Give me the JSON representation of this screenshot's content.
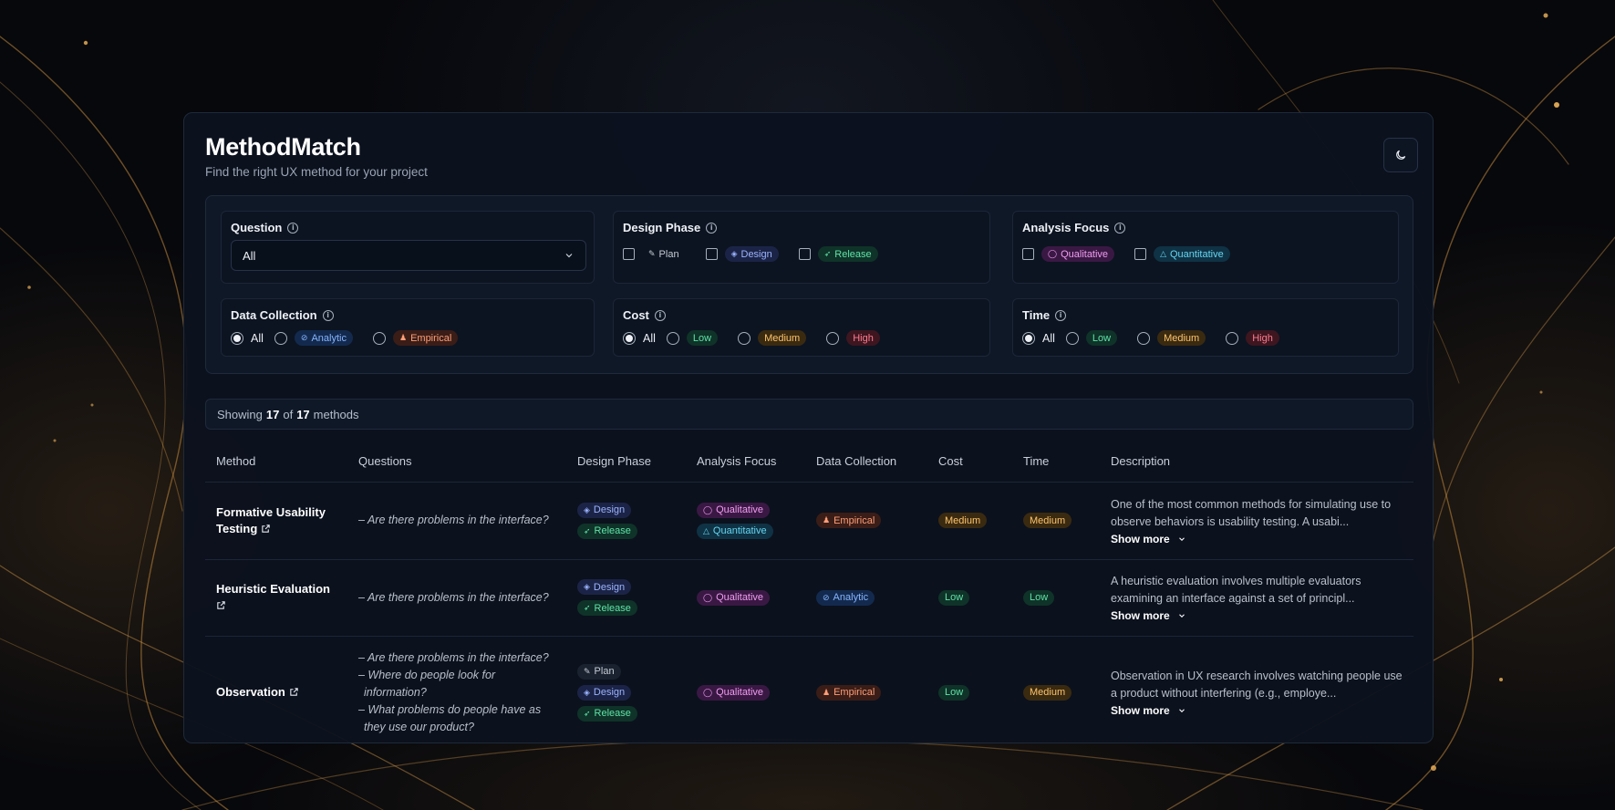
{
  "app": {
    "title": "MethodMatch",
    "subtitle": "Find the right UX method for your project",
    "theme_icon": "moon-icon"
  },
  "filters": {
    "question": {
      "label": "Question",
      "value": "All"
    },
    "design_phase": {
      "label": "Design Phase",
      "options": [
        "Plan",
        "Design",
        "Release"
      ]
    },
    "analysis_focus": {
      "label": "Analysis Focus",
      "options": [
        "Qualitative",
        "Quantitative"
      ]
    },
    "data_collection": {
      "label": "Data Collection",
      "selected": "All",
      "options": [
        "All",
        "Analytic",
        "Empirical"
      ]
    },
    "cost": {
      "label": "Cost",
      "selected": "All",
      "options": [
        "All",
        "Low",
        "Medium",
        "High"
      ]
    },
    "time": {
      "label": "Time",
      "selected": "All",
      "options": [
        "All",
        "Low",
        "Medium",
        "High"
      ]
    }
  },
  "showing": {
    "prefix": "Showing",
    "shown": "17",
    "of": "of",
    "total": "17",
    "suffix": "methods"
  },
  "table": {
    "headers": [
      "Method",
      "Questions",
      "Design Phase",
      "Analysis Focus",
      "Data Collection",
      "Cost",
      "Time",
      "Description"
    ],
    "rows": [
      {
        "method": "Formative Usability Testing",
        "questions": [
          "– Are there problems in the interface?"
        ],
        "phases": [
          "Design",
          "Release"
        ],
        "focus": [
          "Qualitative",
          "Quantitative"
        ],
        "collection": "Empirical",
        "cost": "Medium",
        "time": "Medium",
        "description": "One of the most common methods for simulating use to observe behaviors is usability testing. A usabi...",
        "more": "Show more"
      },
      {
        "method": "Heuristic Evaluation",
        "questions": [
          "– Are there problems in the interface?"
        ],
        "phases": [
          "Design",
          "Release"
        ],
        "focus": [
          "Qualitative"
        ],
        "collection": "Analytic",
        "cost": "Low",
        "time": "Low",
        "description": "A heuristic evaluation involves multiple evaluators examining an interface against a set of principl...",
        "more": "Show more"
      },
      {
        "method": "Observation",
        "questions": [
          "– Are there problems in the interface?",
          "– Where do people look for information?",
          "– What problems do people have as they use our product?"
        ],
        "phases": [
          "Plan",
          "Design",
          "Release"
        ],
        "focus": [
          "Qualitative"
        ],
        "collection": "Empirical",
        "cost": "Low",
        "time": "Medium",
        "description": "Observation in UX research involves watching people use a product without interfering (e.g., employe...",
        "more": "Show more"
      }
    ]
  }
}
